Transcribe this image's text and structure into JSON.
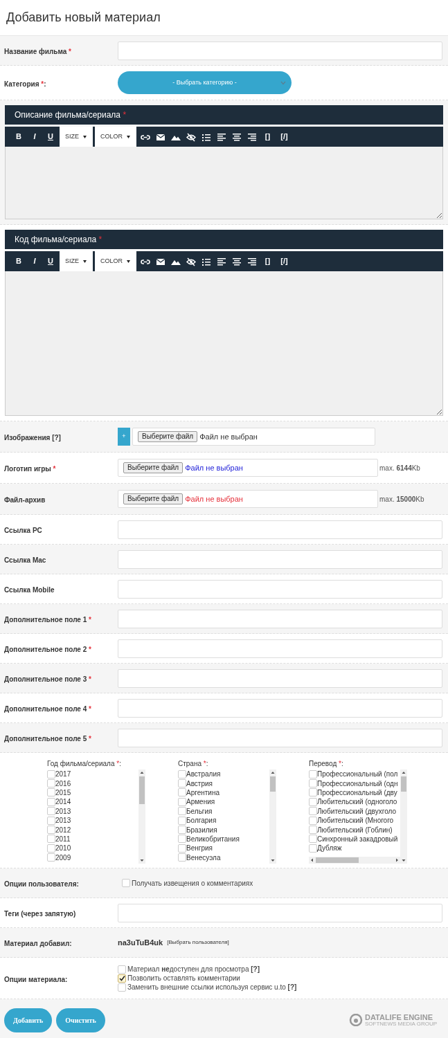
{
  "title": "Добавить новый материал",
  "rows": [
    {
      "kind": "text",
      "label": "Название фильма",
      "required_mark": "*"
    },
    {
      "kind": "select",
      "label": "Категория",
      "required_mark": "*",
      "suffix": ":",
      "value": "- Выбрать категорию -"
    },
    {
      "kind": "editor",
      "label": "Описание фильма/сериала",
      "required_mark": "*",
      "toolbar": {
        "format": [
          "B",
          "I",
          "U"
        ],
        "dropdowns": [
          "SIZE",
          "COLOR"
        ],
        "tags": [
          "[]",
          "[/]"
        ]
      }
    },
    {
      "kind": "editor",
      "label": "Код фильма/сериала",
      "required_mark": "*",
      "toolbar": {
        "format": [
          "B",
          "I",
          "U"
        ],
        "dropdowns": [
          "SIZE",
          "COLOR"
        ],
        "tags": [
          "[]",
          "[/]"
        ]
      }
    },
    {
      "kind": "upload",
      "label": "Изображения [?]",
      "add": "+",
      "button": "Выберите файл",
      "status": "Файл не выбран",
      "color": "#333333"
    },
    {
      "kind": "file",
      "label": "Логотип игры",
      "required_mark": "*",
      "button": "Выберите файл",
      "status": "Файл не выбран",
      "color": "#2323d9",
      "limit": "max. **6144**Kb"
    },
    {
      "kind": "file",
      "label": "Файл-архив",
      "button": "Выберите файл",
      "status": "Файл не выбран",
      "color": "#e5303a",
      "limit": "max. **15000**Kb"
    },
    {
      "kind": "text",
      "label": "Ссылка PC"
    },
    {
      "kind": "text",
      "label": "Ссылка Mac"
    },
    {
      "kind": "text",
      "label": "Ссылка Mobile"
    },
    {
      "kind": "text",
      "label": "Дополнительное поле 1",
      "required_mark": "*"
    },
    {
      "kind": "text",
      "label": "Дополнительное поле 2",
      "required_mark": "*"
    },
    {
      "kind": "text",
      "label": "Дополнительное поле 3",
      "required_mark": "*"
    },
    {
      "kind": "text",
      "label": "Дополнительное поле 4",
      "required_mark": "*"
    },
    {
      "kind": "text",
      "label": "Дополнительное поле 5",
      "required_mark": "*"
    },
    {
      "kind": "lists",
      "columns": [
        {
          "label": "Год фильма/сериала",
          "required_mark": "*",
          "suffix": ":",
          "items": [
            {
              "text": "2017",
              "checked": false
            },
            {
              "text": "2016",
              "checked": false
            },
            {
              "text": "2015",
              "checked": false
            },
            {
              "text": "2014",
              "checked": false
            },
            {
              "text": "2013",
              "checked": false
            },
            {
              "text": "2013",
              "checked": false
            },
            {
              "text": "2012",
              "checked": false
            },
            {
              "text": "2011",
              "checked": false
            },
            {
              "text": "2010",
              "checked": false
            },
            {
              "text": "2009",
              "checked": false
            }
          ]
        },
        {
          "label": "Страна",
          "required_mark": "*",
          "suffix": ":",
          "items": [
            {
              "text": "Австралия",
              "checked": false
            },
            {
              "text": "Австрия",
              "checked": false
            },
            {
              "text": "Аргентина",
              "checked": false
            },
            {
              "text": "Армения",
              "checked": false
            },
            {
              "text": "Бельгия",
              "checked": false
            },
            {
              "text": "Болгария",
              "checked": false
            },
            {
              "text": "Бразилия",
              "checked": false
            },
            {
              "text": "Великобритания",
              "checked": false
            },
            {
              "text": "Венгрия",
              "checked": false
            },
            {
              "text": "Венесуэла",
              "checked": false
            }
          ]
        },
        {
          "label": "Перевод",
          "required_mark": "*",
          "suffix": ":",
          "items": [
            {
              "text": "Профессиональный (пол",
              "checked": false
            },
            {
              "text": "Профессиональный (одн",
              "checked": false
            },
            {
              "text": "Профессиональный (дву",
              "checked": false
            },
            {
              "text": "Любительский (одноголо",
              "checked": false
            },
            {
              "text": "Любительский (двухголо",
              "checked": false
            },
            {
              "text": "Любительский (Многого",
              "checked": false
            },
            {
              "text": "Любительский (Гоблин)",
              "checked": false
            },
            {
              "text": "Синхронный закадровый",
              "checked": false
            },
            {
              "text": "Дубляж",
              "checked": false
            }
          ]
        }
      ]
    },
    {
      "kind": "checks",
      "label": "Опции пользователя:",
      "options": [
        {
          "text": "Получать извещения о комментариях",
          "checked": false
        }
      ]
    },
    {
      "kind": "text",
      "label": "Теги (через запятую)"
    },
    {
      "kind": "author",
      "label": "Материал добавил:",
      "user": "na3uTuB4uk",
      "link": "[Выбрать пользователя]"
    },
    {
      "kind": "checks",
      "label": "Опции материала:",
      "options": [
        {
          "text": "Материал **не**доступен для просмотра **[?]**",
          "checked": false
        },
        {
          "text": "Позволить оставлять комментарии",
          "checked": true
        },
        {
          "text": "Заменить внешние ссылки используя сервис u.to **[?]**",
          "checked": false
        }
      ]
    }
  ],
  "footer": {
    "buttons": [
      "Добавить",
      "Очистить"
    ],
    "logo": {
      "name": "DATALIFE ENGINE",
      "tagline": "SOFTNEWS MEDIA GROUP"
    }
  }
}
